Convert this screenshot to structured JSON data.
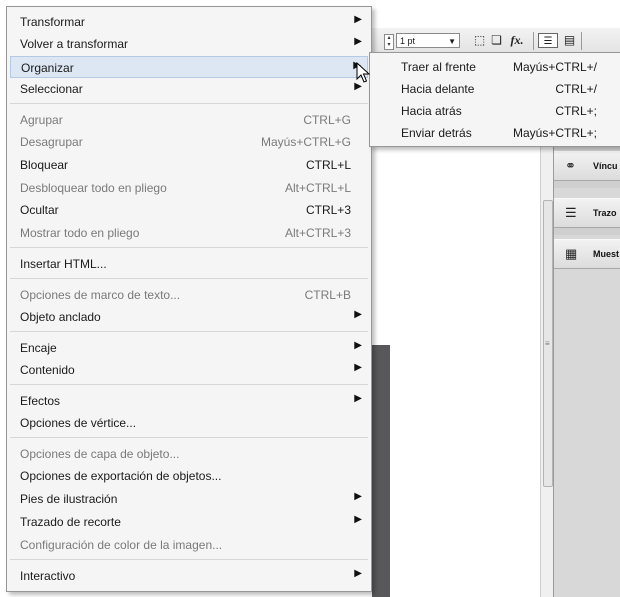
{
  "toolbar": {
    "stroke_weight": "1 pt",
    "stroke_dropdown_icon": "triangle-down",
    "fx_label": "fx."
  },
  "panels": [
    {
      "label": "Víncu",
      "icon": "links-icon"
    },
    {
      "label": "Trazo",
      "icon": "stroke-icon"
    },
    {
      "label": "Muest",
      "icon": "swatches-icon"
    }
  ],
  "menu": {
    "items": [
      {
        "label": "Transformar",
        "shortcut": "",
        "submenu": true,
        "disabled": false
      },
      {
        "label": "Volver a transformar",
        "shortcut": "",
        "submenu": true,
        "disabled": false
      },
      {
        "label": "Organizar",
        "shortcut": "",
        "submenu": true,
        "disabled": false,
        "highlighted": true
      },
      {
        "label": "Seleccionar",
        "shortcut": "",
        "submenu": true,
        "disabled": false
      },
      {
        "label": "Agrupar",
        "shortcut": "CTRL+G",
        "submenu": false,
        "disabled": true
      },
      {
        "label": "Desagrupar",
        "shortcut": "Mayús+CTRL+G",
        "submenu": false,
        "disabled": true
      },
      {
        "label": "Bloquear",
        "shortcut": "CTRL+L",
        "submenu": false,
        "disabled": false
      },
      {
        "label": "Desbloquear todo en pliego",
        "shortcut": "Alt+CTRL+L",
        "submenu": false,
        "disabled": true
      },
      {
        "label": "Ocultar",
        "shortcut": "CTRL+3",
        "submenu": false,
        "disabled": false
      },
      {
        "label": "Mostrar todo en pliego",
        "shortcut": "Alt+CTRL+3",
        "submenu": false,
        "disabled": true
      },
      {
        "label": "Insertar HTML...",
        "shortcut": "",
        "submenu": false,
        "disabled": false
      },
      {
        "label": "Opciones de marco de texto...",
        "shortcut": "CTRL+B",
        "submenu": false,
        "disabled": true
      },
      {
        "label": "Objeto anclado",
        "shortcut": "",
        "submenu": true,
        "disabled": false
      },
      {
        "label": "Encaje",
        "shortcut": "",
        "submenu": true,
        "disabled": false
      },
      {
        "label": "Contenido",
        "shortcut": "",
        "submenu": true,
        "disabled": false
      },
      {
        "label": "Efectos",
        "shortcut": "",
        "submenu": true,
        "disabled": false
      },
      {
        "label": "Opciones de vértice...",
        "shortcut": "",
        "submenu": false,
        "disabled": false
      },
      {
        "label": "Opciones de capa de objeto...",
        "shortcut": "",
        "submenu": false,
        "disabled": true
      },
      {
        "label": "Opciones de exportación de objetos...",
        "shortcut": "",
        "submenu": false,
        "disabled": false
      },
      {
        "label": "Pies de ilustración",
        "shortcut": "",
        "submenu": true,
        "disabled": false
      },
      {
        "label": "Trazado de recorte",
        "shortcut": "",
        "submenu": true,
        "disabled": false
      },
      {
        "label": "Configuración de color de la imagen...",
        "shortcut": "",
        "submenu": false,
        "disabled": true
      },
      {
        "label": "Interactivo",
        "shortcut": "",
        "submenu": true,
        "disabled": false
      }
    ]
  },
  "submenu": {
    "items": [
      {
        "label": "Traer al frente",
        "shortcut": "Mayús+CTRL+/"
      },
      {
        "label": "Hacia delante",
        "shortcut": "CTRL+/"
      },
      {
        "label": "Hacia atrás",
        "shortcut": "CTRL+;"
      },
      {
        "label": "Enviar detrás",
        "shortcut": "Mayús+CTRL+;"
      }
    ]
  }
}
